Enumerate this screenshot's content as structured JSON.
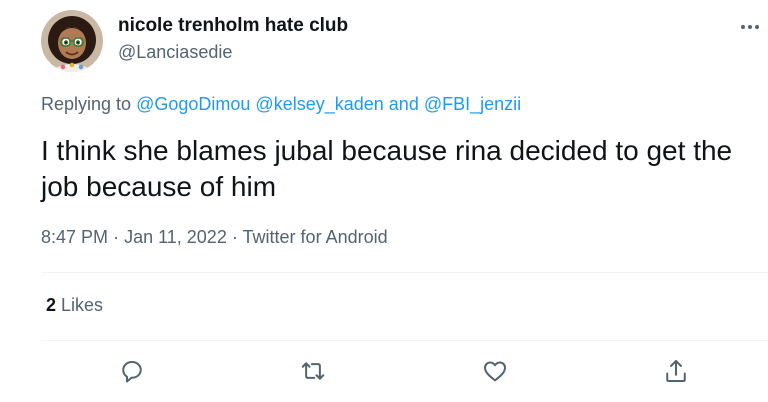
{
  "author": {
    "display_name": "nicole trenholm hate club",
    "handle": "@Lanciasedie",
    "avatar_icon": "avatar-image"
  },
  "more_icon": "more-horizontal-icon",
  "reply_context": {
    "prefix": "Replying to",
    "mention_1": "@GogoDimou",
    "mention_2": "@kelsey_kaden",
    "conjunction": "and",
    "mention_3": "@FBI_jenzii"
  },
  "tweet": {
    "text": "I think she blames jubal because rina decided to get the job because of him"
  },
  "meta": {
    "time": "8:47 PM",
    "separator": "·",
    "date": "Jan 11, 2022",
    "source": "Twitter for Android"
  },
  "stats": {
    "likes_count": "2",
    "likes_label": "Likes"
  },
  "actions": [
    {
      "name": "reply",
      "icon": "reply-icon"
    },
    {
      "name": "retweet",
      "icon": "retweet-icon"
    },
    {
      "name": "like",
      "icon": "heart-icon"
    },
    {
      "name": "share",
      "icon": "share-icon"
    }
  ],
  "colors": {
    "link": "#1d9bf0",
    "secondary_text": "#536471",
    "primary_text": "#0f1419",
    "divider": "#eff3f4"
  }
}
